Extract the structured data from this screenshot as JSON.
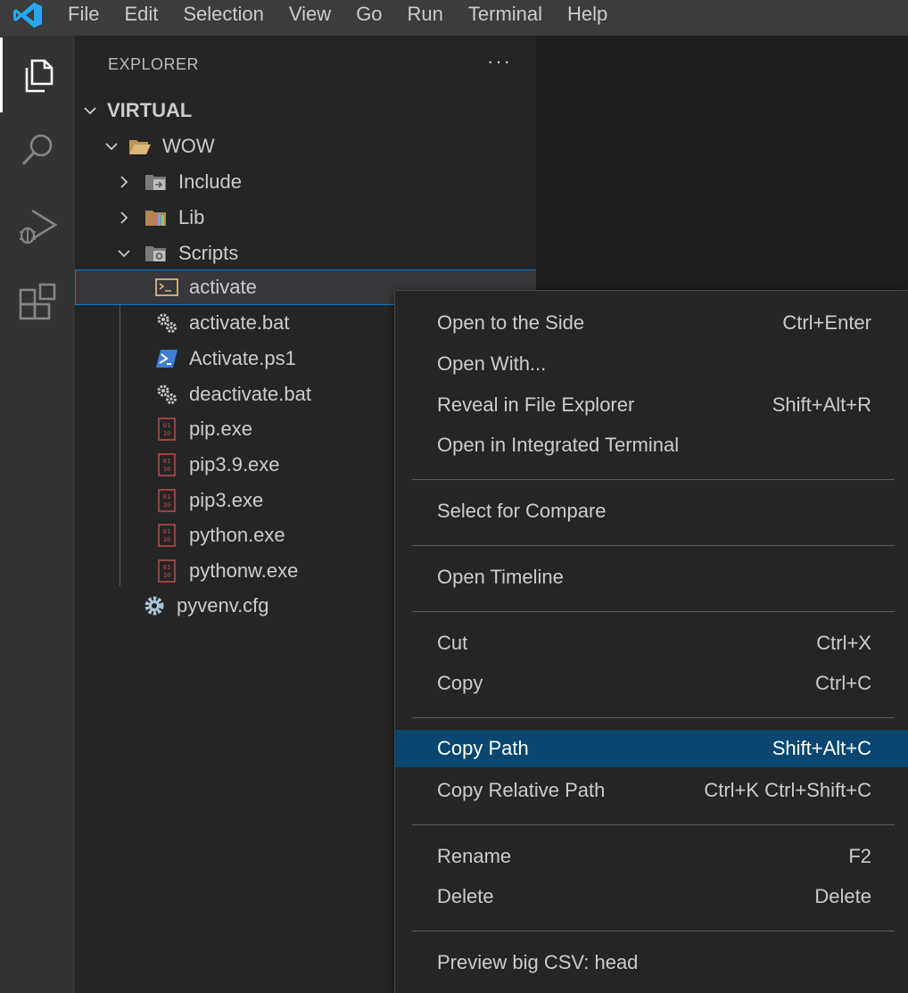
{
  "menubar": [
    "File",
    "Edit",
    "Selection",
    "View",
    "Go",
    "Run",
    "Terminal",
    "Help"
  ],
  "activity_icons": [
    "explorer-icon",
    "search-icon",
    "run-debug-icon",
    "extensions-icon"
  ],
  "explorer": {
    "title": "EXPLORER",
    "more": "···",
    "root": "VIRTUAL",
    "items": [
      {
        "label": "WOW",
        "icon": "folder-open-icon",
        "expanded": true
      },
      {
        "label": "Include",
        "icon": "folder-include-icon",
        "expanded": false
      },
      {
        "label": "Lib",
        "icon": "folder-lib-icon",
        "expanded": false
      },
      {
        "label": "Scripts",
        "icon": "folder-scripts-icon",
        "expanded": true
      },
      {
        "label": "activate",
        "icon": "terminal-file-icon",
        "selected": true
      },
      {
        "label": "activate.bat",
        "icon": "gears-file-icon"
      },
      {
        "label": "Activate.ps1",
        "icon": "powershell-file-icon"
      },
      {
        "label": "deactivate.bat",
        "icon": "gears-file-icon"
      },
      {
        "label": "pip.exe",
        "icon": "binary-file-icon"
      },
      {
        "label": "pip3.9.exe",
        "icon": "binary-file-icon"
      },
      {
        "label": "pip3.exe",
        "icon": "binary-file-icon"
      },
      {
        "label": "python.exe",
        "icon": "binary-file-icon"
      },
      {
        "label": "pythonw.exe",
        "icon": "binary-file-icon"
      },
      {
        "label": "pyvenv.cfg",
        "icon": "settings-file-icon"
      }
    ]
  },
  "context_menu": {
    "items": [
      {
        "label": "Open to the Side",
        "shortcut": "Ctrl+Enter"
      },
      {
        "label": "Open With...",
        "shortcut": ""
      },
      {
        "label": "Reveal in File Explorer",
        "shortcut": "Shift+Alt+R"
      },
      {
        "label": "Open in Integrated Terminal",
        "shortcut": ""
      },
      {
        "label": "Select for Compare",
        "shortcut": ""
      },
      {
        "label": "Open Timeline",
        "shortcut": ""
      },
      {
        "label": "Cut",
        "shortcut": "Ctrl+X"
      },
      {
        "label": "Copy",
        "shortcut": "Ctrl+C"
      },
      {
        "label": "Copy Path",
        "shortcut": "Shift+Alt+C",
        "highlighted": true
      },
      {
        "label": "Copy Relative Path",
        "shortcut": "Ctrl+K Ctrl+Shift+C"
      },
      {
        "label": "Rename",
        "shortcut": "F2"
      },
      {
        "label": "Delete",
        "shortcut": "Delete"
      },
      {
        "label": "Preview big CSV: head",
        "shortcut": ""
      }
    ]
  },
  "colors": {
    "accent": "#007acc",
    "highlight": "#094771",
    "selection_outline": "#007fd4",
    "binary_icon": "#c74a4a",
    "folder": "#dcb67a"
  }
}
